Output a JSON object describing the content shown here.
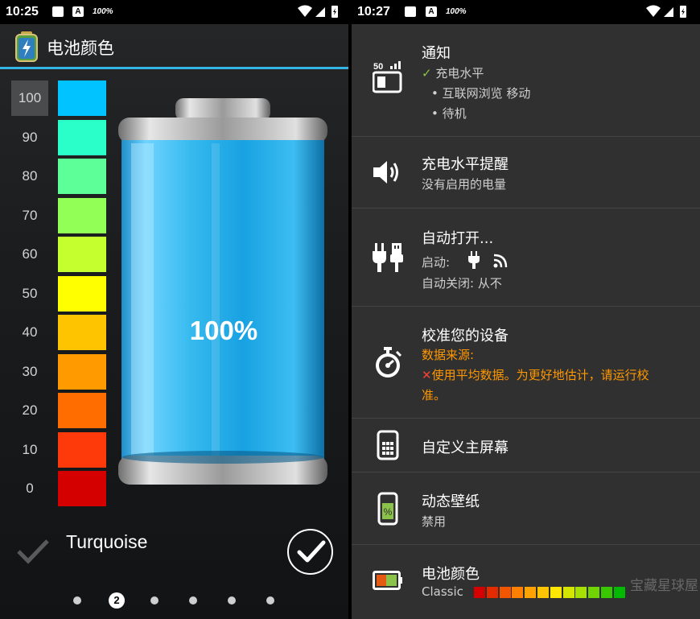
{
  "left": {
    "status": {
      "time": "10:25",
      "battery_text": "100%"
    },
    "app_title": "电池颜色",
    "scale_labels": [
      "100",
      "90",
      "80",
      "70",
      "60",
      "50",
      "40",
      "30",
      "20",
      "10",
      "0"
    ],
    "selected_level": "100",
    "swatch_colors": [
      "#00c3ff",
      "#2bffc9",
      "#5dff98",
      "#92ff56",
      "#c6ff2e",
      "#ffff00",
      "#ffc400",
      "#ff9a00",
      "#ff6d00",
      "#ff3a0a",
      "#d40000"
    ],
    "battery_percent": "100%",
    "color_name": "Turquoise",
    "page_indicator": {
      "active_label": "2",
      "count": 6,
      "active_index": 1
    }
  },
  "right": {
    "status": {
      "time": "10:27",
      "battery_text": "100%"
    },
    "items": [
      {
        "title": "通知",
        "icon": "notification-level-icon",
        "icon_text": "50",
        "lines": [
          {
            "mark": "✓",
            "text": "充电水平"
          },
          {
            "mark": "•",
            "text": "互联网浏览 移动"
          },
          {
            "mark": "•",
            "text": "待机"
          }
        ]
      },
      {
        "title": "充电水平提醒",
        "icon": "speaker-icon",
        "subtitle": "没有启用的电量"
      },
      {
        "title": "自动打开...",
        "icon": "plug-usb-icon",
        "line1_label": "启动:",
        "line2": "自动关闭: 从不"
      },
      {
        "title": "校准您的设备",
        "icon": "stopwatch-icon",
        "line1": "数据来源:",
        "line2_mark": "✕",
        "line2": "使用平均数据。为更好地估计，请运行校",
        "line3": "准。"
      },
      {
        "title": "自定义主屏幕",
        "icon": "phone-widget-icon"
      },
      {
        "title": "动态壁纸",
        "icon": "wallpaper-icon",
        "icon_text": "%",
        "subtitle": "禁用"
      },
      {
        "title": "电池颜色",
        "icon": "battery-color-icon",
        "subtitle": "Classic",
        "bar_colors": [
          "#d50000",
          "#e62a00",
          "#f25500",
          "#ff8000",
          "#ffa200",
          "#ffc400",
          "#ffe600",
          "#d4e600",
          "#a6e000",
          "#6fd400",
          "#39c700",
          "#00b900"
        ]
      }
    ],
    "watermark": "宝藏星球屋"
  }
}
